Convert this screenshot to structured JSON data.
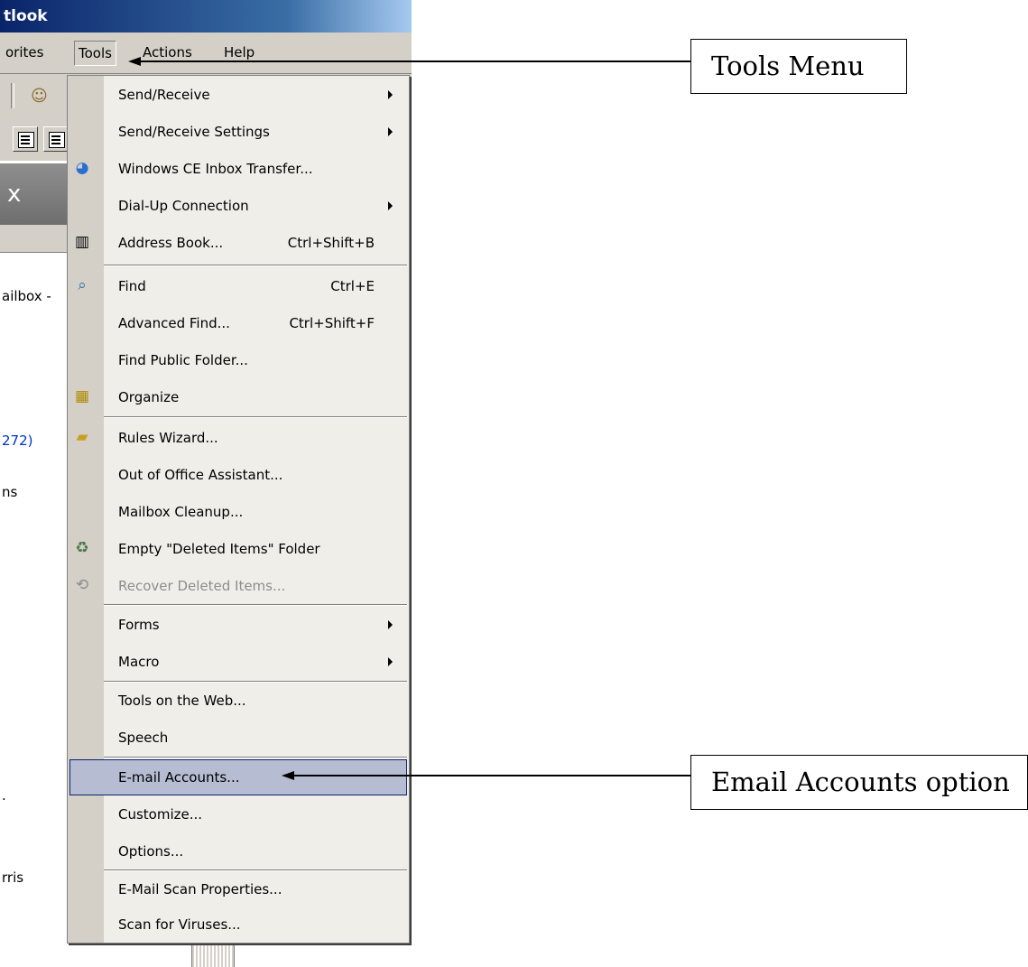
{
  "window": {
    "title": "tlook"
  },
  "menubar": {
    "favorites": "orites",
    "tools": "Tools",
    "actions": "Actions",
    "help": "Help"
  },
  "folder_pane": {
    "header": "x",
    "mailbox": "ailbox -",
    "unread_count": "272)",
    "items_fragment": "ns",
    "dot_fragment": ".",
    "contact_fragment": "rris"
  },
  "tools_menu": {
    "items": [
      {
        "label": "Send/Receive",
        "submenu": true
      },
      {
        "label": "Send/Receive Settings",
        "submenu": true
      },
      {
        "label": "Windows CE Inbox Transfer...",
        "icon": "windows-ce-icon"
      },
      {
        "label": "Dial-Up Connection",
        "submenu": true
      },
      {
        "label": "Address Book...",
        "shortcut": "Ctrl+Shift+B",
        "icon": "address-book-icon"
      },
      {
        "label": "Find",
        "shortcut": "Ctrl+E",
        "icon": "find-icon"
      },
      {
        "label": "Advanced Find...",
        "shortcut": "Ctrl+Shift+F"
      },
      {
        "label": "Find Public Folder..."
      },
      {
        "label": "Organize",
        "icon": "organize-icon"
      },
      {
        "label": "Rules Wizard...",
        "icon": "rules-wizard-icon"
      },
      {
        "label": "Out of Office Assistant..."
      },
      {
        "label": "Mailbox Cleanup..."
      },
      {
        "label": "Empty \"Deleted Items\" Folder",
        "icon": "trash-icon"
      },
      {
        "label": "Recover Deleted Items...",
        "icon": "recover-icon",
        "disabled": true
      },
      {
        "label": "Forms",
        "submenu": true
      },
      {
        "label": "Macro",
        "submenu": true
      },
      {
        "label": "Tools on the Web..."
      },
      {
        "label": "Speech"
      },
      {
        "label": "E-mail Accounts...",
        "selected": true
      },
      {
        "label": "Customize..."
      },
      {
        "label": "Options..."
      },
      {
        "label": "E-Mail Scan Properties..."
      },
      {
        "label": "Scan for Viruses..."
      }
    ]
  },
  "callouts": {
    "tools_menu": "Tools Menu",
    "email_accounts": "Email Accounts option"
  },
  "colors": {
    "menu_highlight": "#b6bdd2",
    "titlebar": "#0a246a",
    "menu_background": "#f0eee8"
  }
}
